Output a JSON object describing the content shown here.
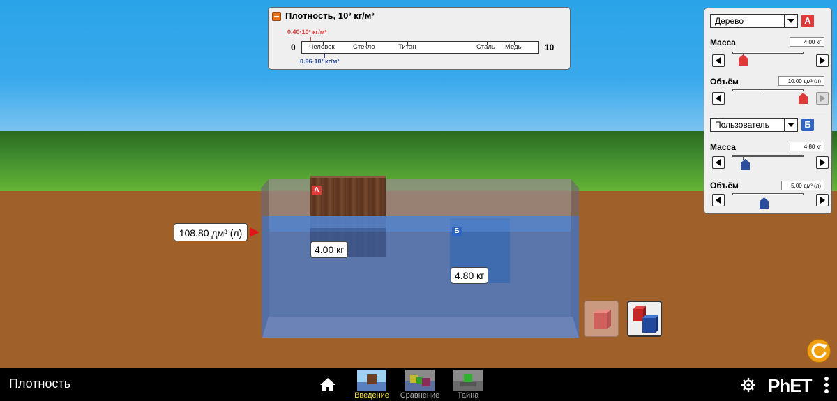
{
  "density_panel": {
    "title": "Плотность, 10³ кг/м³",
    "scale_min": "0",
    "scale_max": "10",
    "materials": [
      "Человек",
      "Стекло",
      "Титан",
      "Сталь",
      "Медь"
    ],
    "marker_a": "0.40·10³ кг/м³",
    "marker_b": "0.96·10³ кг/м³"
  },
  "scene": {
    "volume_readout": "108.80 дм³ (л)",
    "block_a": {
      "tag": "А",
      "mass_label": "4.00 кг"
    },
    "block_b": {
      "tag": "Б",
      "mass_label": "4.80 кг"
    }
  },
  "controls": {
    "block_a": {
      "material": "Дерево",
      "badge": "А",
      "mass_label": "Масса",
      "mass_value": "4.00 кг",
      "volume_label": "Объём",
      "volume_value": "10.00 дм³ (л)",
      "mass_level": 0.14,
      "volume_level": 1.0
    },
    "block_b": {
      "material": "Пользователь",
      "badge": "Б",
      "mass_label": "Масса",
      "mass_value": "4.80 кг",
      "volume_label": "Объём",
      "volume_value": "5.00 дм³ (л)",
      "mass_level": 0.17,
      "volume_level": 0.44
    }
  },
  "navbar": {
    "title": "Плотность",
    "screens": [
      {
        "label": "Введение",
        "active": true
      },
      {
        "label": "Сравнение",
        "active": false
      },
      {
        "label": "Тайна",
        "active": false
      }
    ],
    "logo": "PhET"
  },
  "colors": {
    "accent_a": "#e0393a",
    "accent_b": "#2f66c5",
    "active_tab": "#f2e33a"
  },
  "icons": [
    "collapse-icon",
    "home-icon",
    "gear-icon",
    "menu-icon",
    "reset-icon"
  ]
}
